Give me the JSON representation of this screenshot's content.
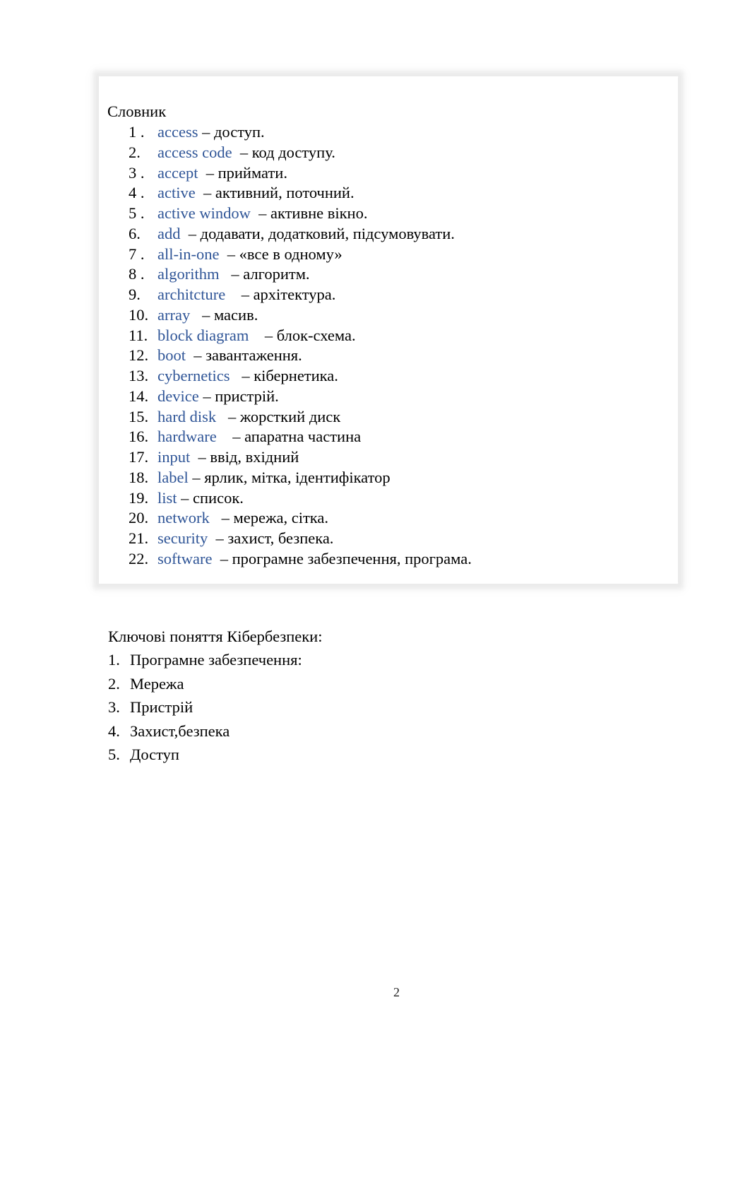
{
  "glossary": {
    "title": "Словник",
    "term_color": "#2f5597",
    "items": [
      {
        "num": "1 .",
        "term": "access",
        "def": " – доступ."
      },
      {
        "num": "2.",
        "term": "access code",
        "def": "  – код доступу."
      },
      {
        "num": "3 .",
        "term": "accept",
        "def": "  – приймати."
      },
      {
        "num": "4 .",
        "term": "active",
        "def": "  – активний, поточний."
      },
      {
        "num": "5 .",
        "term": "active window",
        "def": "  – активне вікно."
      },
      {
        "num": "6.",
        "term": "add",
        "def": "  – додавати, додатковий, підсумовувати."
      },
      {
        "num": "7 .",
        "term": "all-in-one",
        "def": "  – «все в одному»"
      },
      {
        "num": "8 .",
        "term": "algorithm",
        "def": "   – алгоритм."
      },
      {
        "num": "9.",
        "term": "architcture",
        "def": "    – архітектура."
      },
      {
        "num": "10.",
        "term": "array",
        "def": "   – масив."
      },
      {
        "num": "11.",
        "term": "block diagram",
        "def": "    – блок-схема."
      },
      {
        "num": "12.",
        "term": "boot",
        "def": "  – завантаження."
      },
      {
        "num": "13.",
        "term": "cybernetics",
        "def": "   – кібернетика."
      },
      {
        "num": "14.",
        "term": "device",
        "def": " – пристрій."
      },
      {
        "num": "15.",
        "term": "hard disk",
        "def": "   – жорсткий диск"
      },
      {
        "num": "16.",
        "term": "hardware",
        "def": "    – апаратна частина"
      },
      {
        "num": "17.",
        "term": "input",
        "def": "  – ввід, вхідний"
      },
      {
        "num": "18.",
        "term": "label",
        "def": " – ярлик, мітка, ідентифікатор"
      },
      {
        "num": "19.",
        "term": "list",
        "def": " – список."
      },
      {
        "num": "20.",
        "term": "network",
        "def": "   – мережа, сітка."
      },
      {
        "num": "21.",
        "term": "security",
        "def": "  – захист, безпека."
      },
      {
        "num": "22.",
        "term": "software",
        "def": "  – програмне забезпечення, програма."
      }
    ]
  },
  "key_concepts": {
    "title": "Ключові поняття Кібербезпеки:",
    "items": [
      {
        "num": "1.",
        "text": "Програмне забезпечення:"
      },
      {
        "num": "2.",
        "text": "Мережа"
      },
      {
        "num": "3.",
        "text": "Пристрій"
      },
      {
        "num": "4.",
        "text": "Захист,безпека"
      },
      {
        "num": "5.",
        "text": "Доступ"
      }
    ]
  },
  "page_number": "2"
}
